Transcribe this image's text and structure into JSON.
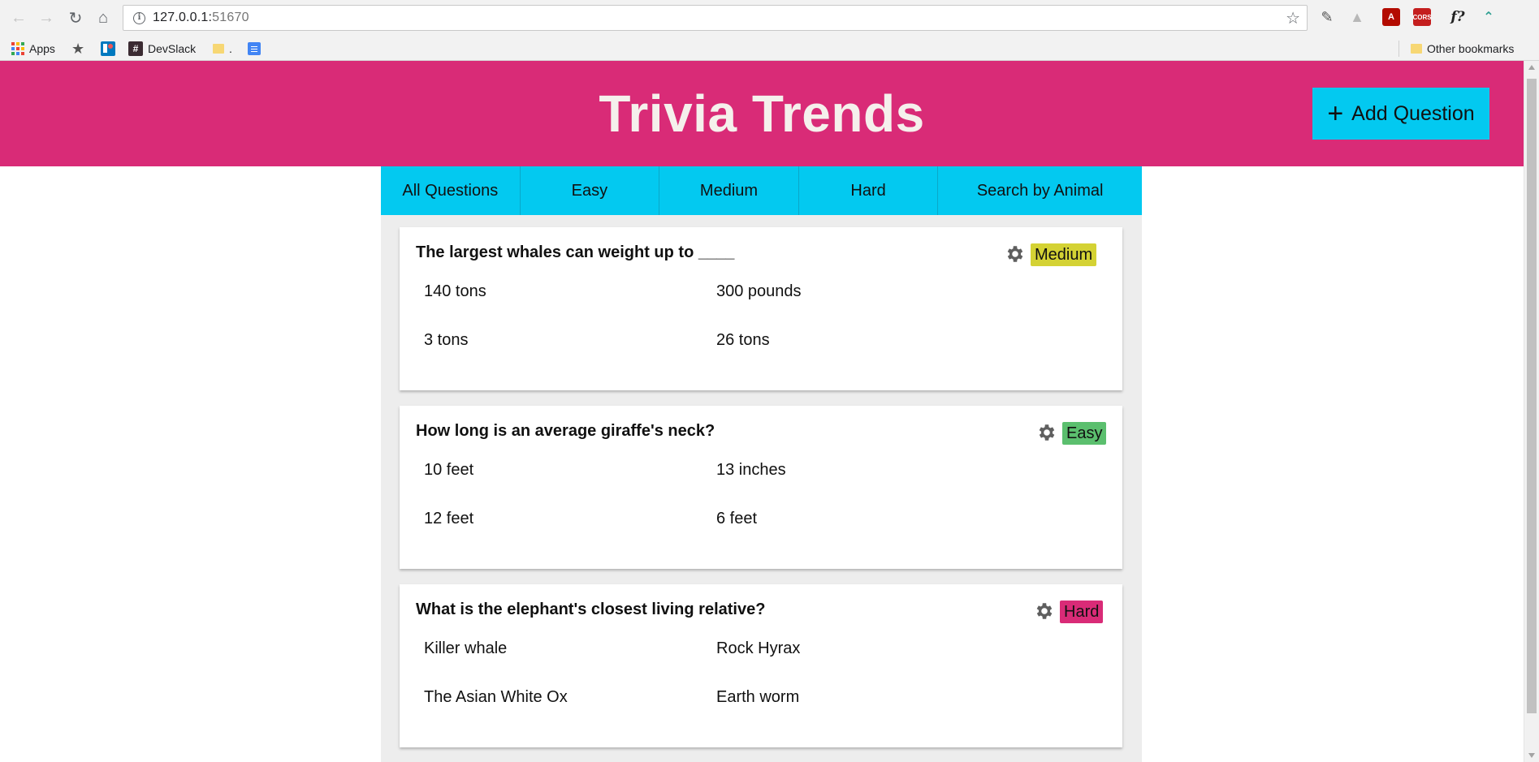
{
  "browser": {
    "url_host": "127.0.0.1:",
    "url_port": "51670",
    "bookmarks": {
      "apps": "Apps",
      "devslack": "DevSlack",
      "folder": ".",
      "other": "Other bookmarks"
    },
    "ext_cors": "CORS",
    "ext_f": "f?"
  },
  "header": {
    "title": "Trivia Trends",
    "add_question": "Add Question"
  },
  "tabs": [
    {
      "label": "All Questions"
    },
    {
      "label": "Easy"
    },
    {
      "label": "Medium"
    },
    {
      "label": "Hard"
    },
    {
      "label": "Search by Animal"
    }
  ],
  "questions": [
    {
      "text": "The largest whales can weight up to ____",
      "difficulty": "Medium",
      "color": "#d4d234",
      "answers": [
        "140 tons",
        "300 pounds",
        "3 tons",
        "26 tons"
      ]
    },
    {
      "text": "How long is an average giraffe's neck?",
      "difficulty": "Easy",
      "color": "#5bbf6e",
      "answers": [
        "10 feet",
        "13 inches",
        "12 feet",
        "6 feet"
      ]
    },
    {
      "text": "What is the elephant's closest living relative?",
      "difficulty": "Hard",
      "color": "#d92b77",
      "answers": [
        "Killer whale",
        "Rock Hyrax",
        "The Asian White Ox",
        "Earth worm"
      ]
    }
  ]
}
